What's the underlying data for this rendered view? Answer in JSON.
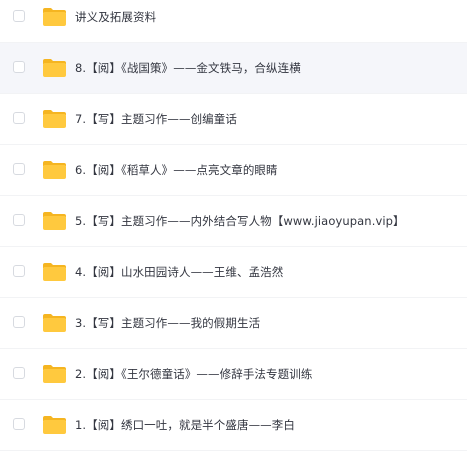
{
  "colors": {
    "folder_body": "#ffc93e",
    "folder_tab": "#f5b521",
    "row_highlight": "#f5f6fa",
    "text": "#333640"
  },
  "icons": {
    "folder": "folder-icon",
    "checkbox": "checkbox-icon"
  },
  "files": [
    {
      "name": "讲义及拓展资料",
      "type": "folder",
      "highlighted": false
    },
    {
      "name": "8.【阅】《战国策》——金文铁马，合纵连横",
      "type": "folder",
      "highlighted": true
    },
    {
      "name": "7.【写】主题习作——创编童话",
      "type": "folder",
      "highlighted": false
    },
    {
      "name": "6.【阅】《稻草人》——点亮文章的眼睛",
      "type": "folder",
      "highlighted": false
    },
    {
      "name": "5.【写】主题习作——内外结合写人物【www.jiaoyupan.vip】",
      "type": "folder",
      "highlighted": false
    },
    {
      "name": "4.【阅】山水田园诗人——王维、孟浩然",
      "type": "folder",
      "highlighted": false
    },
    {
      "name": "3.【写】主题习作——我的假期生活",
      "type": "folder",
      "highlighted": false
    },
    {
      "name": "2.【阅】《王尔德童话》——修辞手法专题训练",
      "type": "folder",
      "highlighted": false
    },
    {
      "name": "1.【阅】绣口一吐，就是半个盛唐——李白",
      "type": "folder",
      "highlighted": false
    }
  ]
}
